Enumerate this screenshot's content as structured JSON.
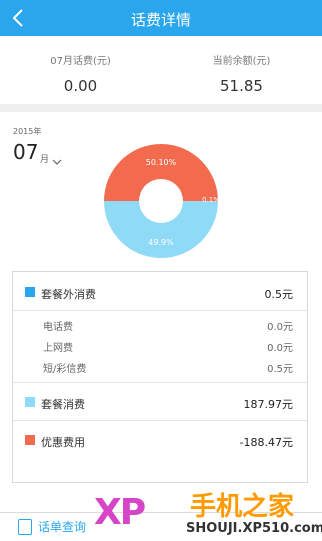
{
  "header": {
    "title": "话费详情"
  },
  "summary": {
    "month_fee_label": "07月话费(元)",
    "month_fee_value": "0.00",
    "balance_label": "当前余额(元)",
    "balance_value": "51.85"
  },
  "period": {
    "year": "2015年",
    "month": "07",
    "month_unit": "月"
  },
  "donut": {
    "segments": [
      {
        "label": "50.10%",
        "value": 50.1,
        "color": "#f26b4f"
      },
      {
        "label": "49.9%",
        "value": 49.9,
        "color": "#8fdaf7"
      }
    ],
    "small_label": "0.1%"
  },
  "details": {
    "extra": {
      "label": "套餐外消费",
      "value": "0.5元",
      "color": "#2aa6ec"
    },
    "sub_items": [
      {
        "label": "电话费",
        "value": "0.0元"
      },
      {
        "label": "上网费",
        "value": "0.0元"
      },
      {
        "label": "短/彩信费",
        "value": "0.5元"
      }
    ],
    "package": {
      "label": "套餐消费",
      "value": "187.97元",
      "color": "#8fdaf7"
    },
    "discount": {
      "label": "优惠费用",
      "value": "-188.47元",
      "color": "#f26b4f"
    }
  },
  "bottom": {
    "button_label": "话单查询"
  },
  "watermark": {
    "logo": "XP",
    "brand": "手机之家",
    "url": "SHOUJI.XP510.com"
  }
}
